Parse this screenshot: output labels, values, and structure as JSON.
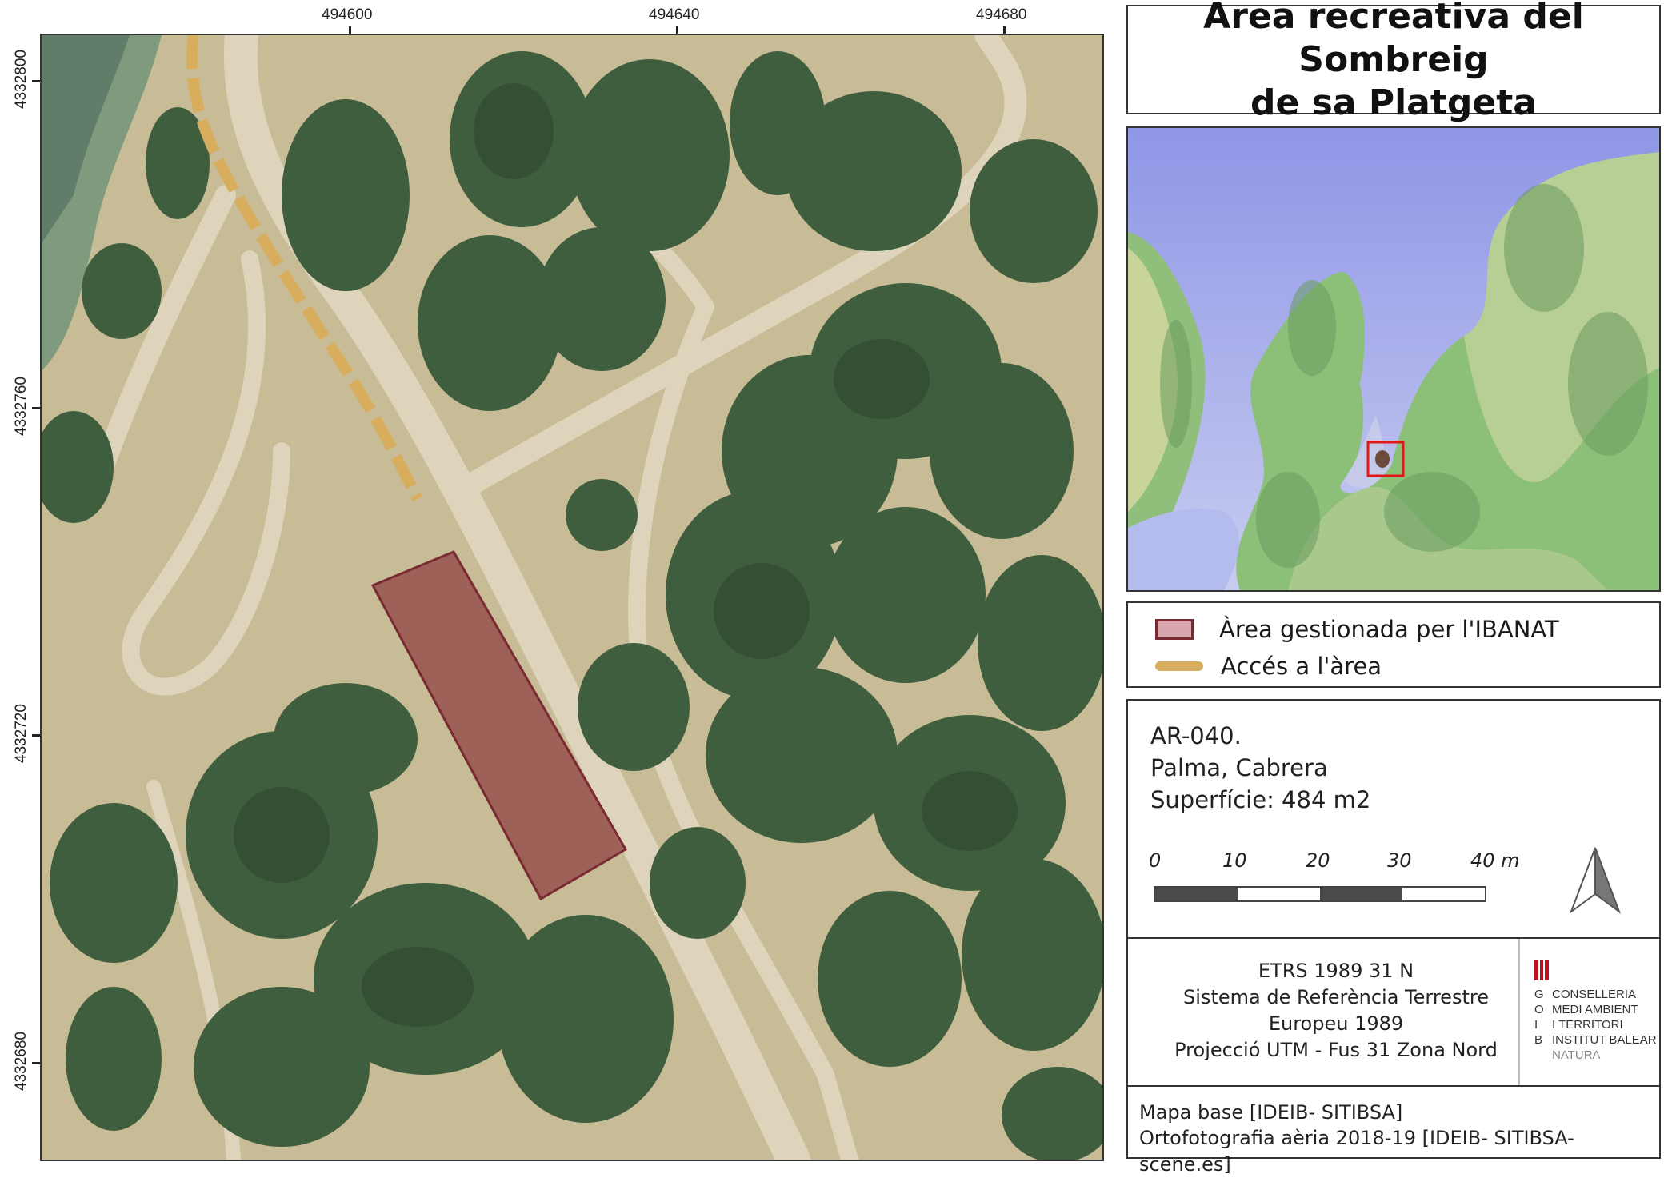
{
  "title": {
    "line1": "Àrea recreativa del Sombreig",
    "line2": "de sa Platgeta"
  },
  "map": {
    "x_ticks": [
      "494600",
      "494640",
      "494680"
    ],
    "y_ticks": [
      "4332800",
      "4332760",
      "4332720",
      "4332680"
    ]
  },
  "legend": {
    "area_label": "Àrea gestionada per l'IBANAT",
    "access_label": "Accés a l'àrea",
    "colors": {
      "area_fill": "#d8a7ad",
      "area_stroke": "#7a2a33",
      "access": "#d9ad5e"
    }
  },
  "info": {
    "code": "AR-040.",
    "location": "Palma, Cabrera",
    "surface": "Superfície: 484 m2"
  },
  "scale_bar": {
    "labels": [
      "0",
      "10",
      "20",
      "30",
      "40 m"
    ]
  },
  "crs": {
    "line1": "ETRS 1989 31 N",
    "line2": "Sistema de Referència Terrestre",
    "line3": "Europeu 1989",
    "line4": "Projecció UTM - Fus 31 Zona Nord"
  },
  "logo": {
    "goib_letters": [
      "G",
      "O",
      "I",
      "B"
    ],
    "lines": [
      "CONSELLERIA",
      "MEDI AMBIENT",
      "I TERRITORI",
      "INSTITUT BALEAR",
      "NATURA"
    ]
  },
  "source": {
    "line1": "Mapa base [IDEIB- SITIBSA]",
    "line2": "Ortofotografia aèria 2018-19 [IDEIB- SITIBSA-scene.es]"
  }
}
